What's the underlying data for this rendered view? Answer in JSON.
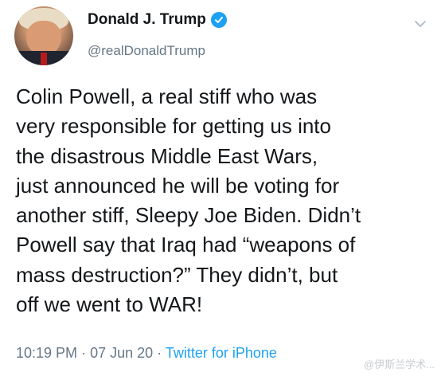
{
  "tweet": {
    "author": {
      "display_name": "Donald J. Trump",
      "handle": "@realDonaldTrump",
      "verified": true
    },
    "text": "Colin Powell, a real stiff who was\nvery responsible for getting us into\nthe disastrous Middle East Wars,\njust announced he will be voting for\nanother stiff, Sleepy Joe Biden. Didn’t\nPowell say that Iraq had “weapons of\nmass destruction?” They didn’t, but\noff we went to WAR!",
    "time": "10:19 PM",
    "separator": "·",
    "date": "07 Jun 20",
    "source": "Twitter for iPhone"
  },
  "watermark": "@伊斯兰学术..."
}
